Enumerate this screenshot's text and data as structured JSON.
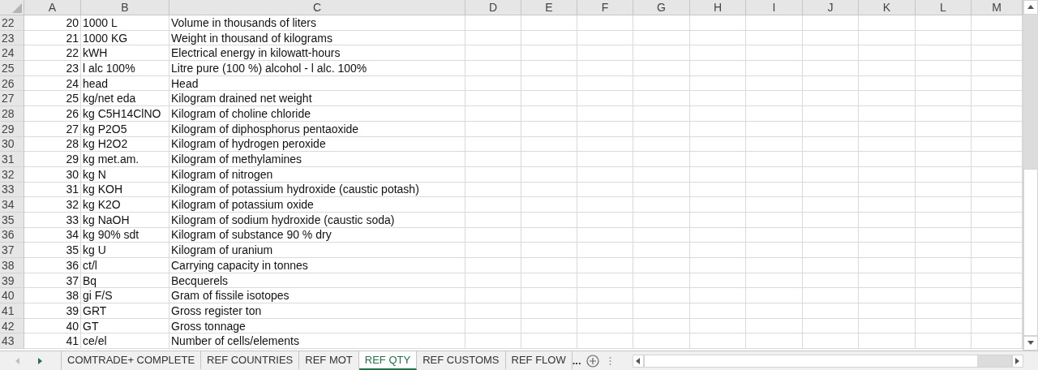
{
  "columns": [
    "A",
    "B",
    "C",
    "D",
    "E",
    "F",
    "G",
    "H",
    "I",
    "J",
    "K",
    "L",
    "M"
  ],
  "rows": [
    {
      "row": "22",
      "a": "20",
      "b": "1000 L",
      "c": "Volume in thousands of liters"
    },
    {
      "row": "23",
      "a": "21",
      "b": "1000 KG",
      "c": "Weight in thousand of kilograms"
    },
    {
      "row": "24",
      "a": "22",
      "b": "kWH",
      "c": "Electrical energy in kilowatt-hours"
    },
    {
      "row": "25",
      "a": "23",
      "b": "l alc 100%",
      "c": "Litre pure (100 %) alcohol - l alc. 100%"
    },
    {
      "row": "26",
      "a": "24",
      "b": "head",
      "c": "Head"
    },
    {
      "row": "27",
      "a": "25",
      "b": "kg/net eda",
      "c": "Kilogram drained net weight"
    },
    {
      "row": "28",
      "a": "26",
      "b": "kg C5H14ClNO",
      "c": "Kilogram of choline chloride"
    },
    {
      "row": "29",
      "a": "27",
      "b": "kg P2O5",
      "c": "Kilogram of diphosphorus pentaoxide"
    },
    {
      "row": "30",
      "a": "28",
      "b": "kg H2O2",
      "c": "Kilogram of hydrogen peroxide"
    },
    {
      "row": "31",
      "a": "29",
      "b": "kg met.am.",
      "c": "Kilogram of methylamines"
    },
    {
      "row": "32",
      "a": "30",
      "b": "kg N",
      "c": "Kilogram of nitrogen"
    },
    {
      "row": "33",
      "a": "31",
      "b": "kg KOH",
      "c": "Kilogram of potassium hydroxide (caustic potash)"
    },
    {
      "row": "34",
      "a": "32",
      "b": "kg K2O",
      "c": "Kilogram of potassium oxide"
    },
    {
      "row": "35",
      "a": "33",
      "b": "kg NaOH",
      "c": "Kilogram of sodium hydroxide (caustic soda)"
    },
    {
      "row": "36",
      "a": "34",
      "b": "kg 90% sdt",
      "c": "Kilogram of substance 90 % dry"
    },
    {
      "row": "37",
      "a": "35",
      "b": "kg U",
      "c": "Kilogram of uranium"
    },
    {
      "row": "38",
      "a": "36",
      "b": "ct/l",
      "c": "Carrying capacity in tonnes"
    },
    {
      "row": "39",
      "a": "37",
      "b": "Bq",
      "c": "Becquerels"
    },
    {
      "row": "40",
      "a": "38",
      "b": "gi F/S",
      "c": "Gram of fissile isotopes"
    },
    {
      "row": "41",
      "a": "39",
      "b": "GRT",
      "c": "Gross register ton"
    },
    {
      "row": "42",
      "a": "40",
      "b": "GT",
      "c": "Gross tonnage"
    },
    {
      "row": "43",
      "a": "41",
      "b": "ce/el",
      "c": "Number of cells/elements"
    }
  ],
  "sheet_tabs": [
    {
      "label": "COMTRADE+ COMPLETE",
      "selected": false
    },
    {
      "label": "REF COUNTRIES",
      "selected": false
    },
    {
      "label": "REF MOT",
      "selected": false
    },
    {
      "label": "REF QTY",
      "selected": true
    },
    {
      "label": "REF CUSTOMS",
      "selected": false
    },
    {
      "label": "REF FLOW",
      "selected": false
    }
  ],
  "more_tabs": "..."
}
